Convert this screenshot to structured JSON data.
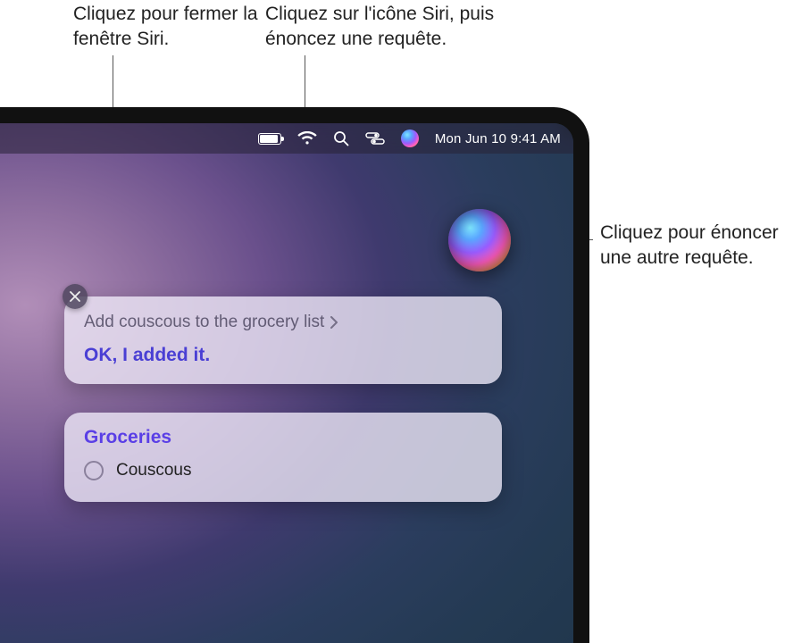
{
  "callouts": {
    "close": "Cliquez pour fermer la fenêtre Siri.",
    "menubar_siri": "Cliquez sur l'icône Siri, puis énoncez une requête.",
    "orb": "Cliquez pour énoncer une autre requête."
  },
  "menubar": {
    "datetime": "Mon Jun 10  9:41 AM"
  },
  "siri": {
    "request": "Add couscous to the grocery list",
    "response": "OK, I added it.",
    "list_title": "Groceries",
    "list_items": [
      "Couscous"
    ]
  }
}
